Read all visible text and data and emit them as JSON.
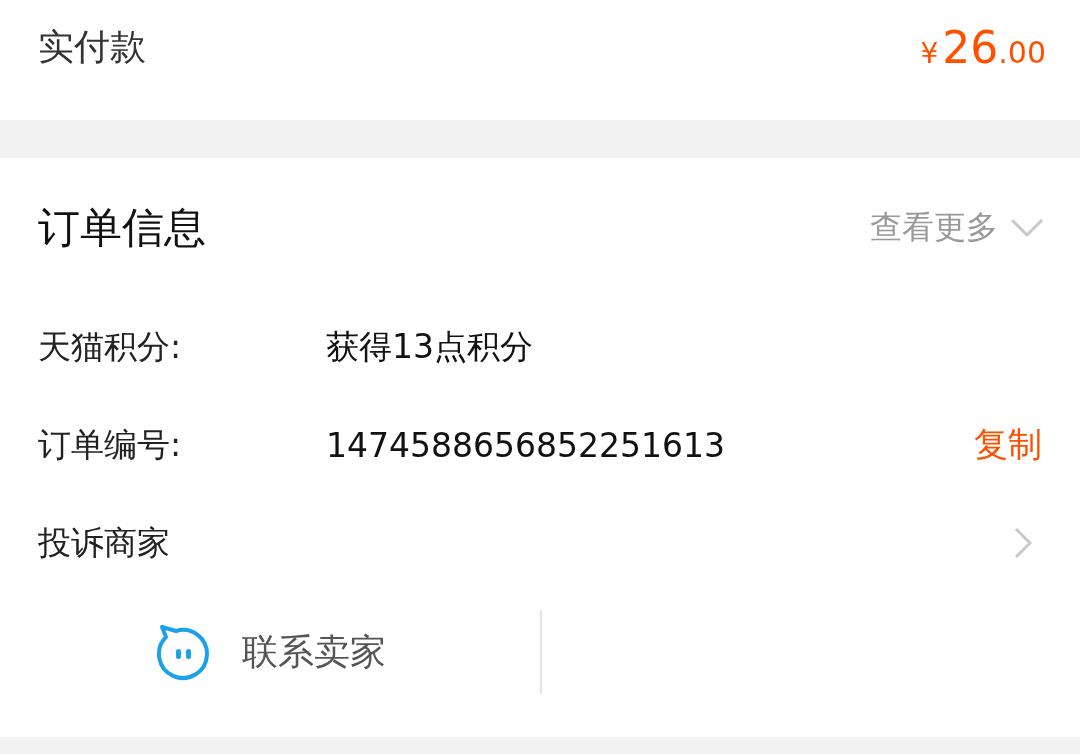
{
  "payment": {
    "label": "实付款",
    "currency": "¥",
    "integer": "26",
    "decimal": ".00"
  },
  "order_info": {
    "title": "订单信息",
    "more": "查看更多",
    "rows": [
      {
        "kind": "value",
        "label": "天猫积分:",
        "value": "获得13点积分"
      },
      {
        "kind": "copy",
        "label": "订单编号:",
        "value": "1474588656852251613",
        "action": "复制"
      },
      {
        "kind": "link",
        "label": "投诉商家"
      }
    ]
  },
  "contact": {
    "label": "联系卖家"
  }
}
